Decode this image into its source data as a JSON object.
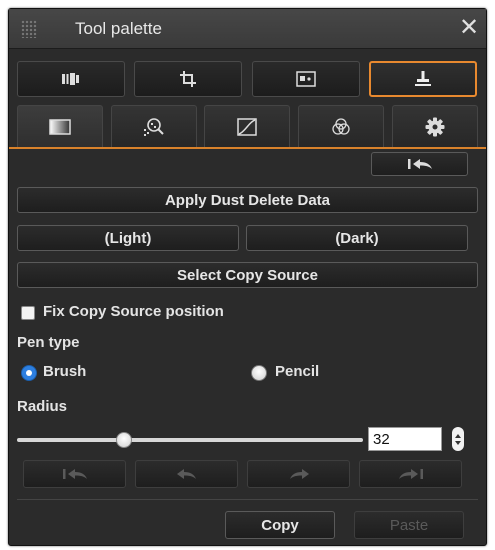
{
  "window": {
    "title": "Tool palette"
  },
  "top_tabs": [
    {
      "icon": "image-strip-icon",
      "active": false
    },
    {
      "icon": "crop-icon",
      "active": false
    },
    {
      "icon": "picture-adjust-icon",
      "active": false
    },
    {
      "icon": "stamp-icon",
      "active": true
    }
  ],
  "sub_tabs": [
    {
      "icon": "gradient-square-icon",
      "active": true
    },
    {
      "icon": "zoom-dust-icon",
      "active": false
    },
    {
      "icon": "tone-curve-icon",
      "active": false
    },
    {
      "icon": "color-circles-icon",
      "active": false
    },
    {
      "icon": "gear-icon",
      "active": false
    }
  ],
  "buttons": {
    "apply_dust": "Apply Dust Delete Data",
    "light": "(Light)",
    "dark": "(Dark)",
    "select_copy_source": "Select Copy Source",
    "copy": "Copy",
    "paste": "Paste"
  },
  "options": {
    "fix_copy_source": "Fix Copy Source position",
    "fix_copy_source_checked": false,
    "pen_type_label": "Pen type",
    "pen_types": [
      "Brush",
      "Pencil"
    ],
    "pen_type_selected": "Brush",
    "radius_label": "Radius",
    "radius_value": "32",
    "radius_fraction": 0.3
  },
  "colors": {
    "accent": "#d9822b",
    "radio_selected": "#2d7fe0",
    "panel_bg": "#2b2b2b"
  }
}
